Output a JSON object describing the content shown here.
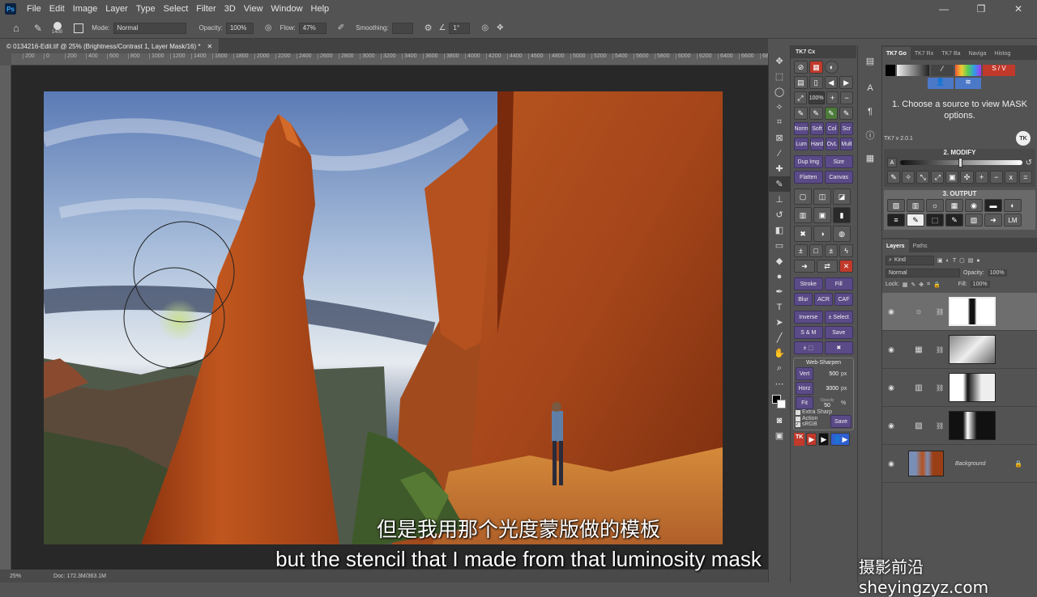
{
  "app": {
    "logo": "Ps"
  },
  "menu": [
    "File",
    "Edit",
    "Image",
    "Layer",
    "Type",
    "Select",
    "Filter",
    "3D",
    "View",
    "Window",
    "Help"
  ],
  "window_controls": [
    "—",
    "❐",
    "✕"
  ],
  "options_bar": {
    "brush_size": "1400",
    "mode_label": "Mode:",
    "mode_value": "Normal",
    "opacity_label": "Opacity:",
    "opacity_value": "100%",
    "flow_label": "Flow:",
    "flow_value": "47%",
    "smoothing_label": "Smoothing:",
    "angle_value": "1°"
  },
  "document_tab": "© 0134216-Edit.tif @ 25% (Brightness/Contrast 1, Layer Mask/16) *",
  "ruler_ticks": [
    "200",
    "0",
    "200",
    "400",
    "600",
    "800",
    "1000",
    "1200",
    "1400",
    "1600",
    "1800",
    "2000",
    "2200",
    "2400",
    "2600",
    "2800",
    "3000",
    "3200",
    "3400",
    "3600",
    "3800",
    "4000",
    "4200",
    "4400",
    "4600",
    "4800",
    "5000",
    "5200",
    "5400",
    "5600",
    "5800",
    "6000",
    "6200",
    "6400",
    "6600",
    "6800"
  ],
  "status_bar": {
    "zoom": "25%",
    "doc": "Doc: 172.3M/363.1M"
  },
  "tk7cx": {
    "header": "TK7 Cx",
    "row_100": "100%",
    "blend_row1": [
      "Norm",
      "Soft",
      "Col",
      "Scr"
    ],
    "blend_row2": [
      "Lum",
      "Hard",
      "OvL",
      "Mult"
    ],
    "dup_img": "Dup Img",
    "size": "Size",
    "flatten": "Flatten",
    "canvas": "Canvas",
    "stroke": "Stroke",
    "fill": "Fill",
    "blur": "Blur",
    "acr": "ACR",
    "caf": "CAF",
    "inverse": "Inverse",
    "pm_select": "± Select",
    "s_and_m": "S & M",
    "save": "Save",
    "web_sharpen": {
      "title": "Web-Sharpen",
      "vert": "Vert",
      "vert_value": "500",
      "vert_unit": "px",
      "horz": "Horz",
      "horz_value": "3000",
      "horz_unit": "px",
      "fit": "Fit",
      "opacity_label": "Opacity",
      "opacity_value": "50",
      "opacity_unit": "%",
      "extra_sharp": "Extra Sharp",
      "action": "Action",
      "srgb": "sRGB",
      "save": "Save"
    },
    "tk_label": "TK"
  },
  "right_panel": {
    "tabs": [
      "TK7 Go",
      "TK7 Rx",
      "TK7 Ba",
      "Naviga",
      "Histog"
    ],
    "sv_label": "S / V",
    "instruction": "1. Choose a source to view MASK options.",
    "version": "TK7 v 2.0.1",
    "tk_badge": "TK",
    "modify_title": "2. MODIFY",
    "modify_a": "A",
    "modify_buttons": [
      "+",
      "−",
      "x",
      "="
    ],
    "output_title": "3. OUTPUT",
    "lm": "LM",
    "layers": {
      "tabs": [
        "Layers",
        "Paths"
      ],
      "kind": "Kind",
      "blend": "Normal",
      "opacity_label": "Opacity:",
      "opacity_value": "100%",
      "lock_label": "Lock:",
      "fill_label": "Fill:",
      "fill_value": "100%",
      "background_name": "Background"
    }
  },
  "subtitles": {
    "chinese": "但是我用那个光度蒙版做的模板",
    "english": "but the stencil that I made from that luminosity mask"
  },
  "watermark": "摄影前沿 sheyingzyz.com",
  "colors": {
    "accent_red": "#c0392b",
    "accent_purple": "#5a4a87",
    "sky_blue": "#6f8fc0",
    "rock_orange": "#b5511f"
  }
}
